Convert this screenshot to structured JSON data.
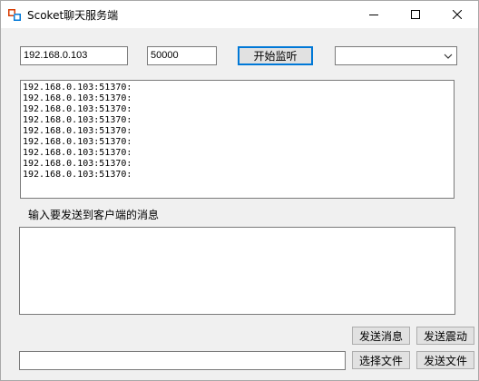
{
  "window": {
    "title": "Scoket聊天服务端"
  },
  "controls": {
    "ip_value": "192.168.0.103",
    "port_value": "50000",
    "listen_button": "开始监听",
    "client_select_value": ""
  },
  "log": {
    "lines": [
      "192.168.0.103:51370:",
      "192.168.0.103:51370:",
      "192.168.0.103:51370:",
      "192.168.0.103:51370:",
      "192.168.0.103:51370:",
      "192.168.0.103:51370:",
      "192.168.0.103:51370:",
      "192.168.0.103:51370:",
      "192.168.0.103:51370:"
    ]
  },
  "message": {
    "label": "输入要发送到客户端的消息",
    "value": ""
  },
  "actions": {
    "send_message": "发送消息",
    "send_shake": "发送震动",
    "select_file": "选择文件",
    "send_file": "发送文件"
  },
  "file": {
    "path_value": ""
  },
  "colors": {
    "accent": "#0078d7",
    "icon_red": "#d83b01",
    "icon_blue": "#0078d7"
  }
}
